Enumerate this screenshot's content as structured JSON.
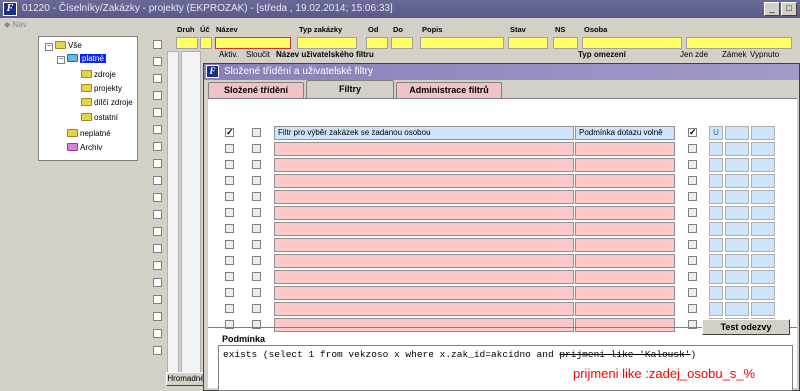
{
  "window": {
    "title": "01220 - Číselníky/Zakázky - projekty (EKPROZAK) - [středa , 19.02.2014; 15:06:33]",
    "app_icon": "F",
    "minimize_label": "_",
    "maximize_label": "□"
  },
  "nav": {
    "label": "Nav"
  },
  "tree": {
    "root": "Vše",
    "items": [
      {
        "label": "platné",
        "selected": true
      },
      {
        "label": "zdroje"
      },
      {
        "label": "projekty"
      },
      {
        "label": "dílčí zdroje"
      },
      {
        "label": "ostatní"
      },
      {
        "label": "neplatné"
      },
      {
        "label": "Archiv"
      }
    ]
  },
  "grid": {
    "headers": [
      "Druh",
      "Úč",
      "Název",
      "Typ zakázky",
      "Od",
      "Do",
      "Popis",
      "Stav",
      "NS",
      "Osoba"
    ],
    "bottom_button": "Hromadné"
  },
  "dialog": {
    "title": "Složené třídění a uživatelské filtry",
    "icon": "F",
    "tabs": [
      "Složené třídění",
      "Filtry",
      "Administrace filtrů"
    ],
    "columns": {
      "active": "Aktiv.",
      "merge": "Sloučit",
      "name": "Název uživatelského filtru",
      "type": "Typ omezení",
      "only_here": "Jen zde",
      "lock": "Zámek",
      "off": "Vypnuto"
    },
    "rows": [
      {
        "name": "Filtr pro výběr zakázek se zadanou osobou",
        "type": "Podmínka dotazu volně",
        "active": true,
        "merge": false,
        "only_here": true,
        "lock": "U"
      }
    ],
    "empty_rows": 12,
    "condition_label": "Podmínka",
    "test_button": "Test odezvy",
    "condition_text_plain": "exists (select 1 from vekzoso x where x.zak_id=akcidno and ",
    "condition_text_struck": "prijmeni like 'Kalousk'",
    "condition_text_end": ")",
    "annotation": "prijmeni like :zadej_osobu_s_%",
    "annotation_color": "#ff0000"
  }
}
